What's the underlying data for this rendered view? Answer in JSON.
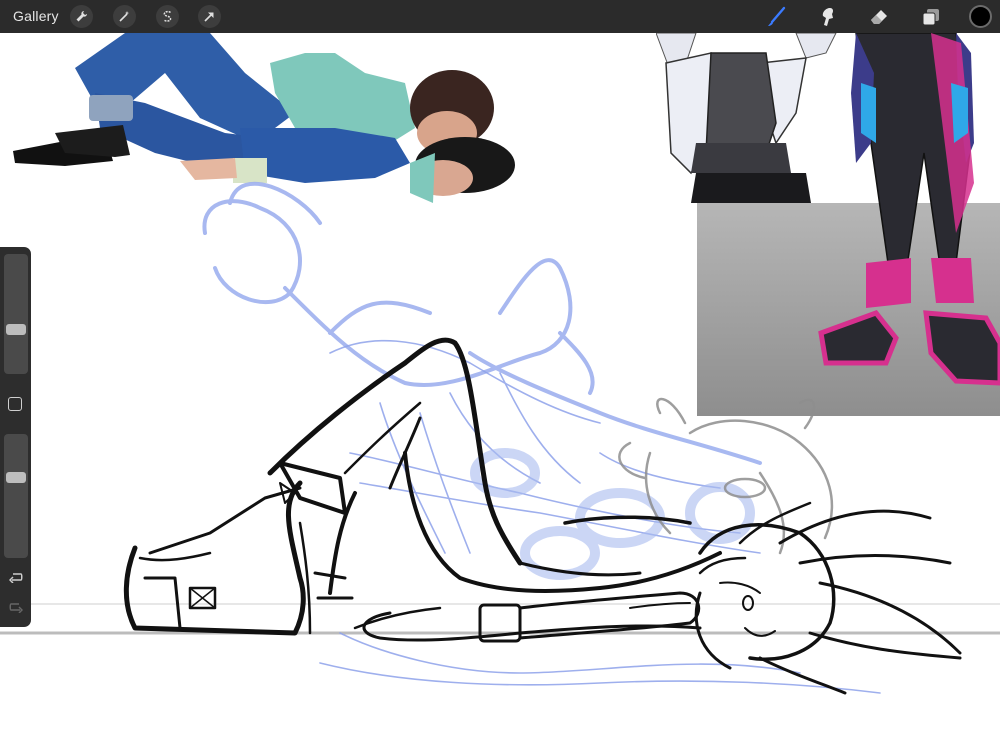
{
  "toolbar": {
    "gallery_label": "Gallery",
    "left_tools": [
      "wrench-icon",
      "magic-wand-icon",
      "selection-icon",
      "transform-arrow-icon"
    ],
    "right_tools": [
      "brush-icon",
      "smudge-icon",
      "eraser-icon",
      "layers-icon"
    ],
    "active_tool": "brush-icon",
    "active_tool_color": "#3b7bff",
    "current_color": "#000000"
  },
  "sidebar": {
    "brush_size_level": 0.36,
    "opacity_level": 0.66,
    "undo_icon": "undo-icon",
    "redo_icon": "redo-icon",
    "modify_icon": "square-icon"
  },
  "canvas": {
    "background": "#ffffff",
    "sketch_color": "#9fb1ef",
    "ink_color": "#111111"
  }
}
